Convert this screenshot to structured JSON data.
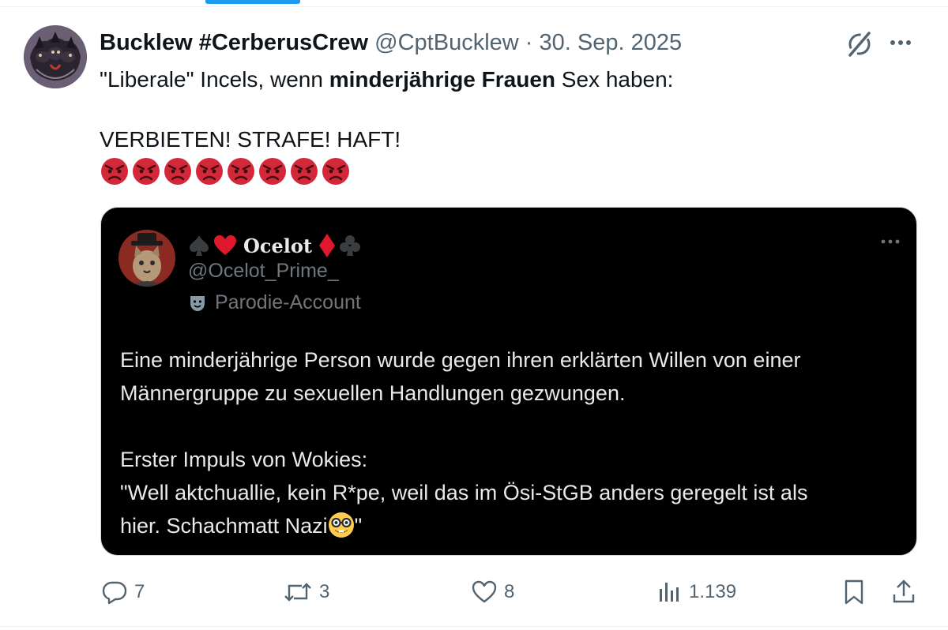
{
  "tweet": {
    "display_name": "Bucklew #CerberusCrew",
    "handle": "@CptBucklew",
    "separator": "·",
    "date": "30. Sep. 2025",
    "avatar_icon": "cerberus-avatar",
    "text_line1_a": "\"Liberale\" Incels, wenn ",
    "text_line1_bold": "minderjährige Frauen",
    "text_line1_b": " Sex haben:",
    "text_line2": "VERBIETEN! STRAFE! HAFT!",
    "emoji_name": "angry-face-icon",
    "emoji_count": 8
  },
  "header_icons": {
    "grok": "grok-icon",
    "more": "more-icon"
  },
  "quote": {
    "display_name": "Ocelot",
    "handle": "@Ocelot_Prime_",
    "parody_label": "Parodie-Account",
    "body_line1": "Eine minderjährige Person wurde gegen ihren erklärten Willen von einer",
    "body_line2": "Männergruppe zu sexuellen Handlungen gezwungen.",
    "body_line3": "Erster Impuls von Wokies:",
    "body_line4": "\"Well aktchuallie, kein R*pe, weil das im Ösi-StGB anders geregelt ist als",
    "body_line5_a": "hier. Schachmatt Nazi",
    "body_line5_b": "\"",
    "colors": {
      "background": "#000000",
      "text": "#e7e9ea",
      "muted": "#71767b",
      "red": "#e0182d"
    }
  },
  "actions": {
    "replies": "7",
    "reposts": "3",
    "likes": "8",
    "views": "1.139"
  },
  "colors": {
    "accent": "#1d9bf0",
    "text": "#0f1419",
    "muted": "#536471"
  }
}
